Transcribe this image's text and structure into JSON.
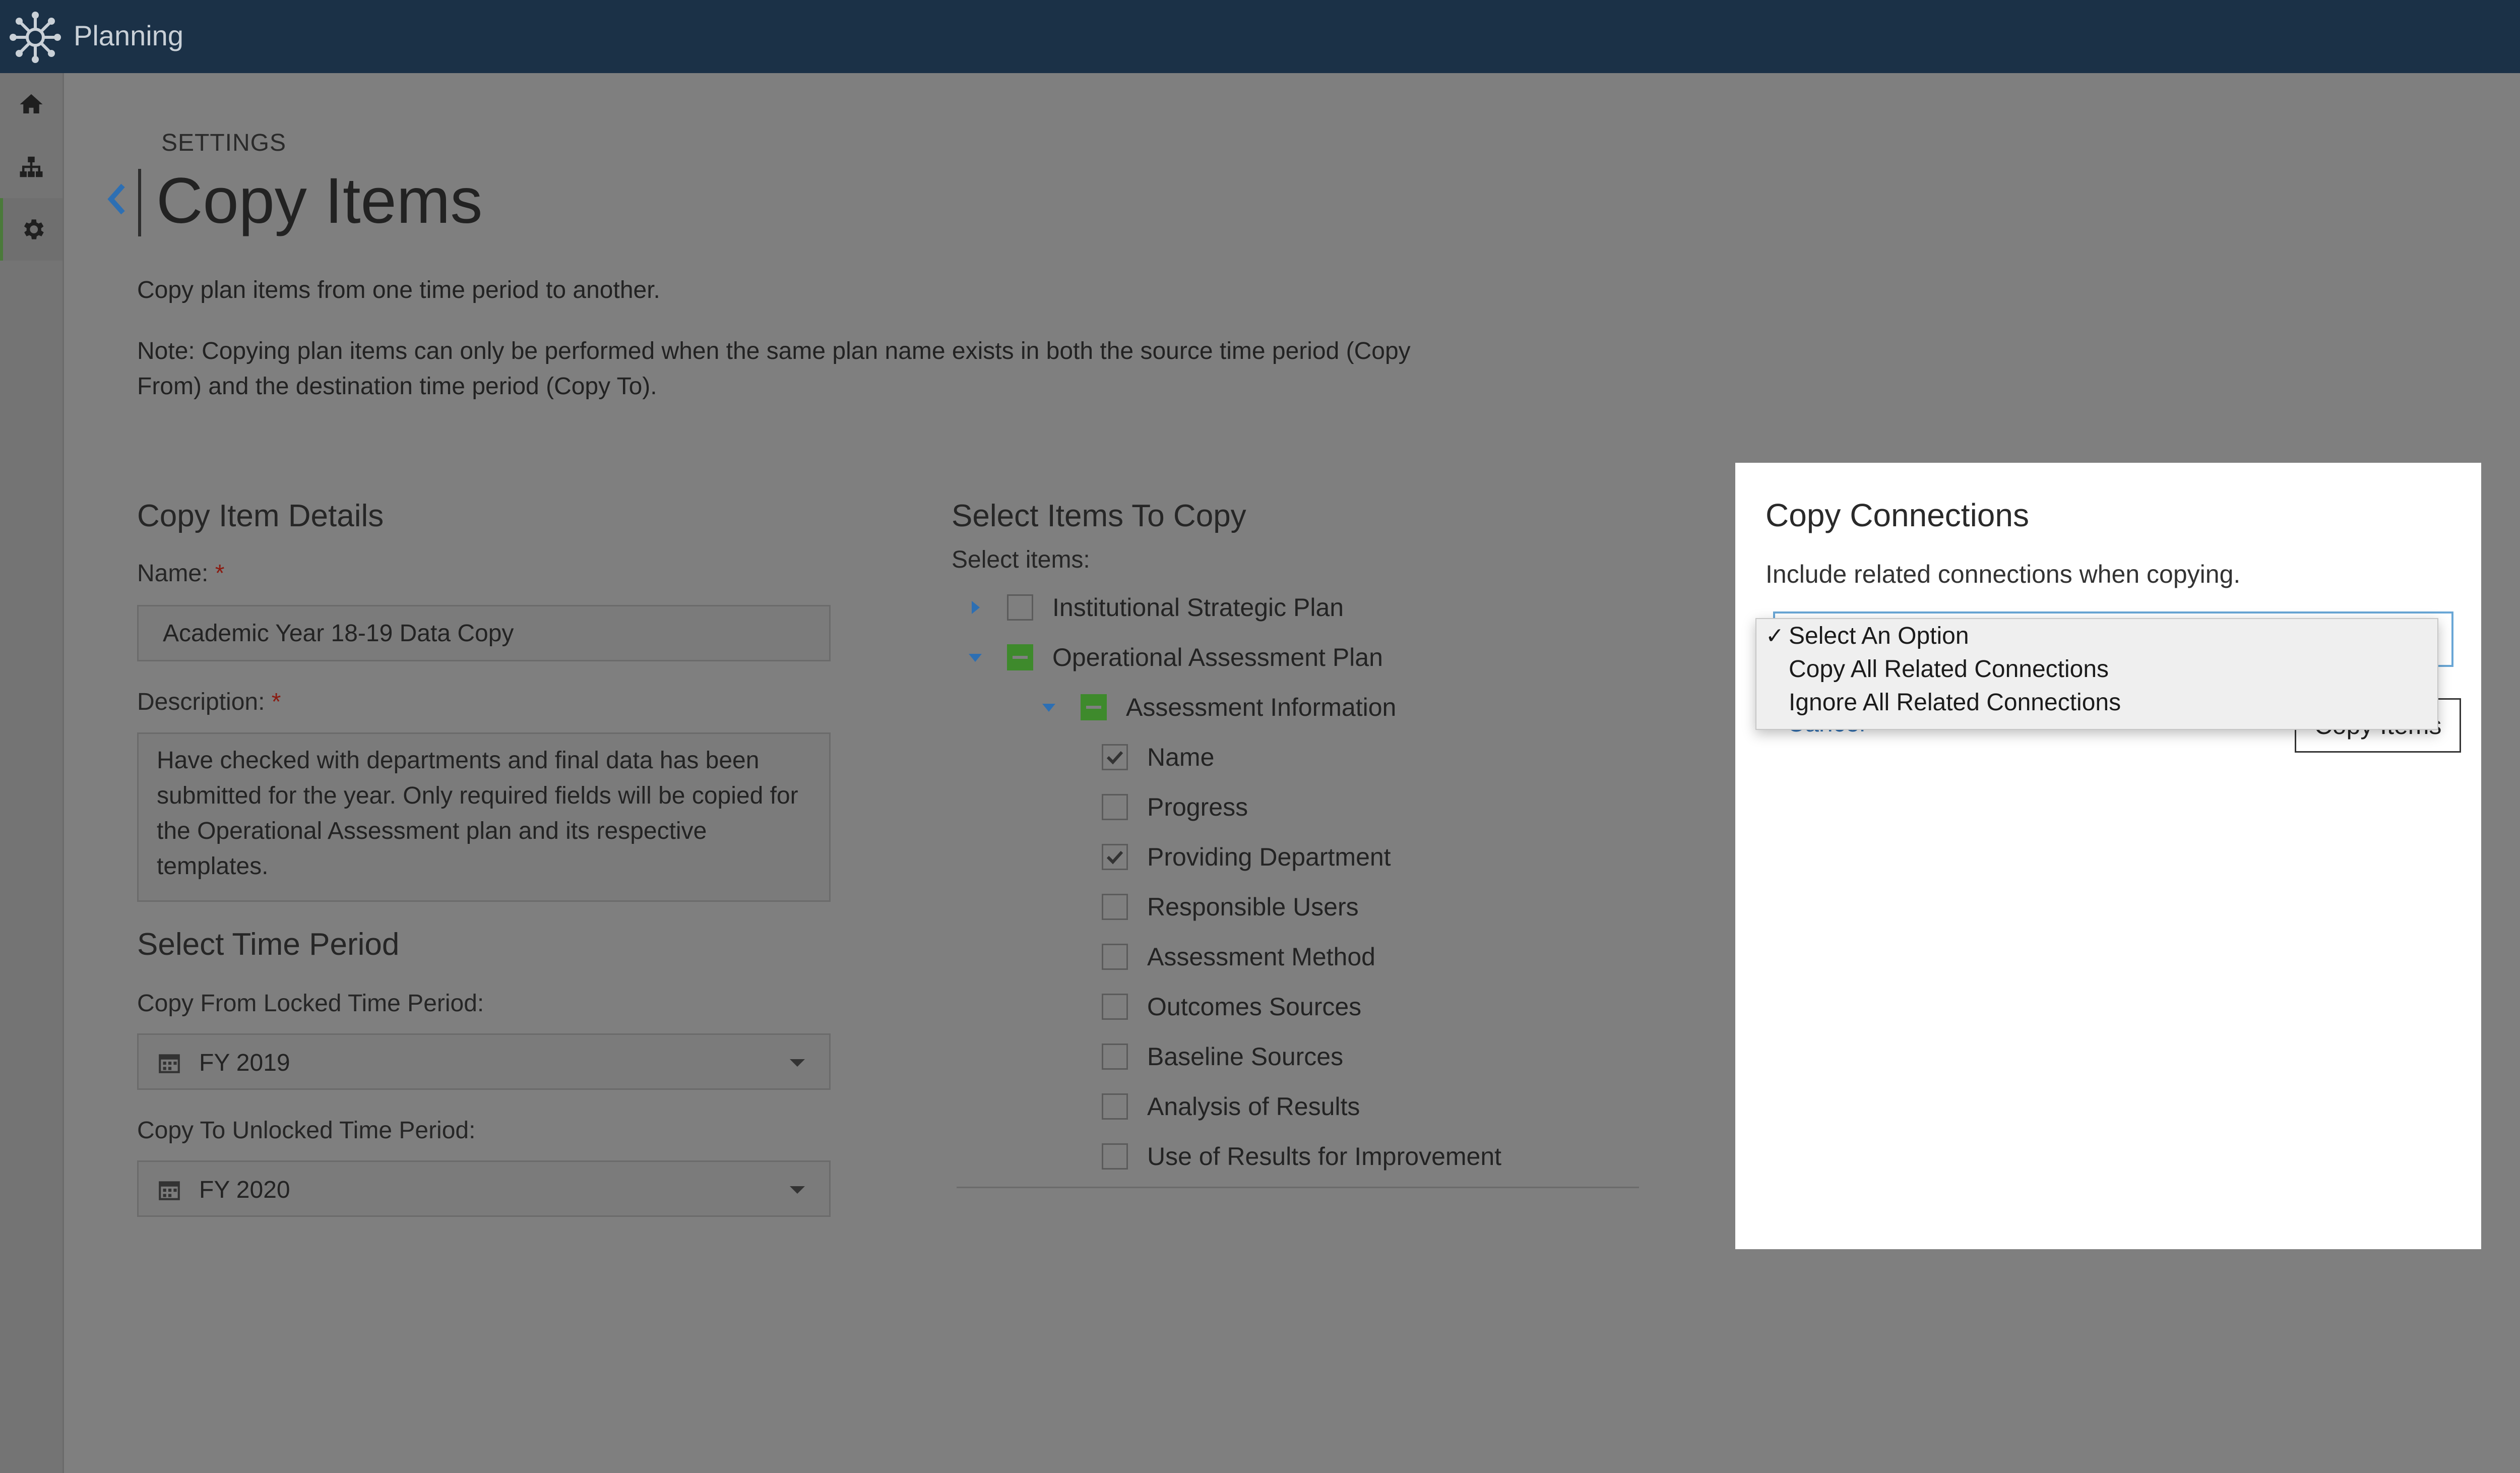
{
  "app": {
    "title": "Planning"
  },
  "breadcrumb": "SETTINGS",
  "page": {
    "title": "Copy Items",
    "intro": "Copy plan items from one time period to another.",
    "note": "Note: Copying plan items can only be performed when the same plan name exists in both the source time period (Copy From) and the destination time period (Copy To)."
  },
  "details": {
    "heading": "Copy Item Details",
    "name_label": "Name:",
    "name_value": "Academic Year 18-19 Data Copy",
    "desc_label": "Description:",
    "desc_value": "Have checked with departments and final data has been submitted for the year. Only required fields will be copied for the Operational Assessment plan and its respective templates.",
    "required_mark": "*"
  },
  "time_period": {
    "heading": "Select Time Period",
    "from_label": "Copy From Locked Time Period:",
    "from_value": "FY 2019",
    "to_label": "Copy To Unlocked Time Period:",
    "to_value": "FY 2020"
  },
  "items": {
    "heading": "Select Items To Copy",
    "label": "Select items:",
    "tree": [
      {
        "label": "Institutional Strategic Plan",
        "state": "unchecked",
        "expanded": false
      },
      {
        "label": "Operational Assessment Plan",
        "state": "partial",
        "expanded": true
      },
      {
        "label": "Assessment Information",
        "state": "partial",
        "expanded": true
      },
      {
        "label": "Name",
        "state": "checked"
      },
      {
        "label": "Progress",
        "state": "unchecked"
      },
      {
        "label": "Providing Department",
        "state": "checked"
      },
      {
        "label": "Responsible Users",
        "state": "unchecked"
      },
      {
        "label": "Assessment Method",
        "state": "unchecked"
      },
      {
        "label": "Outcomes Sources",
        "state": "unchecked"
      },
      {
        "label": "Baseline Sources",
        "state": "unchecked"
      },
      {
        "label": "Analysis of Results",
        "state": "unchecked"
      },
      {
        "label": "Use of Results for Improvement",
        "state": "unchecked"
      }
    ]
  },
  "modal": {
    "title": "Copy Connections",
    "subtitle": "Include related connections when copying.",
    "cancel_label": "Cancel",
    "copy_button": "Copy Items",
    "select": {
      "selected": "Select An Option",
      "options": [
        "Select An Option",
        "Copy All Related Connections",
        "Ignore All Related Connections"
      ],
      "check_mark": "✓"
    }
  },
  "colors": {
    "topbar": "#1b3147",
    "accent_blue": "#2d6fb3",
    "check_green": "#3e8a2c",
    "required": "#8a1c12"
  }
}
